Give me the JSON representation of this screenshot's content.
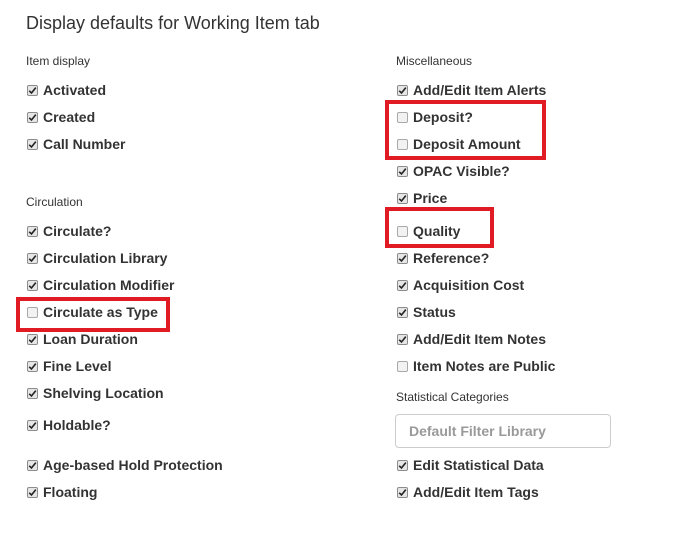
{
  "title": "Display defaults for Working Item tab",
  "sections": {
    "item_display": {
      "heading": "Item display",
      "items": [
        {
          "label": "Activated",
          "checked": true
        },
        {
          "label": "Created",
          "checked": true
        },
        {
          "label": "Call Number",
          "checked": true
        }
      ]
    },
    "circulation": {
      "heading": "Circulation",
      "items": [
        {
          "label": "Circulate?",
          "checked": true
        },
        {
          "label": "Circulation Library",
          "checked": true
        },
        {
          "label": "Circulation Modifier",
          "checked": true
        },
        {
          "label": "Circulate as Type",
          "checked": false
        },
        {
          "label": "Loan Duration",
          "checked": true
        },
        {
          "label": "Fine Level",
          "checked": true
        },
        {
          "label": "Shelving Location",
          "checked": true
        },
        {
          "label": "Holdable?",
          "checked": true
        },
        {
          "label": "Age-based Hold Protection",
          "checked": true
        },
        {
          "label": "Floating",
          "checked": true
        }
      ]
    },
    "miscellaneous": {
      "heading": "Miscellaneous",
      "items": [
        {
          "label": "Add/Edit Item Alerts",
          "checked": true
        },
        {
          "label": "Deposit?",
          "checked": false
        },
        {
          "label": "Deposit Amount",
          "checked": false
        },
        {
          "label": "OPAC Visible?",
          "checked": true
        },
        {
          "label": "Price",
          "checked": true
        },
        {
          "label": "Quality",
          "checked": false
        },
        {
          "label": "Reference?",
          "checked": true
        },
        {
          "label": "Acquisition Cost",
          "checked": true
        },
        {
          "label": "Status",
          "checked": true
        },
        {
          "label": "Add/Edit Item Notes",
          "checked": true
        },
        {
          "label": "Item Notes are Public",
          "checked": false
        }
      ]
    },
    "statistical_categories": {
      "heading": "Statistical Categories",
      "filter_placeholder": "Default Filter Library",
      "items": [
        {
          "label": "Edit Statistical Data",
          "checked": true
        },
        {
          "label": "Add/Edit Item Tags",
          "checked": true
        }
      ]
    }
  },
  "colors": {
    "highlight": "#e01b24"
  }
}
